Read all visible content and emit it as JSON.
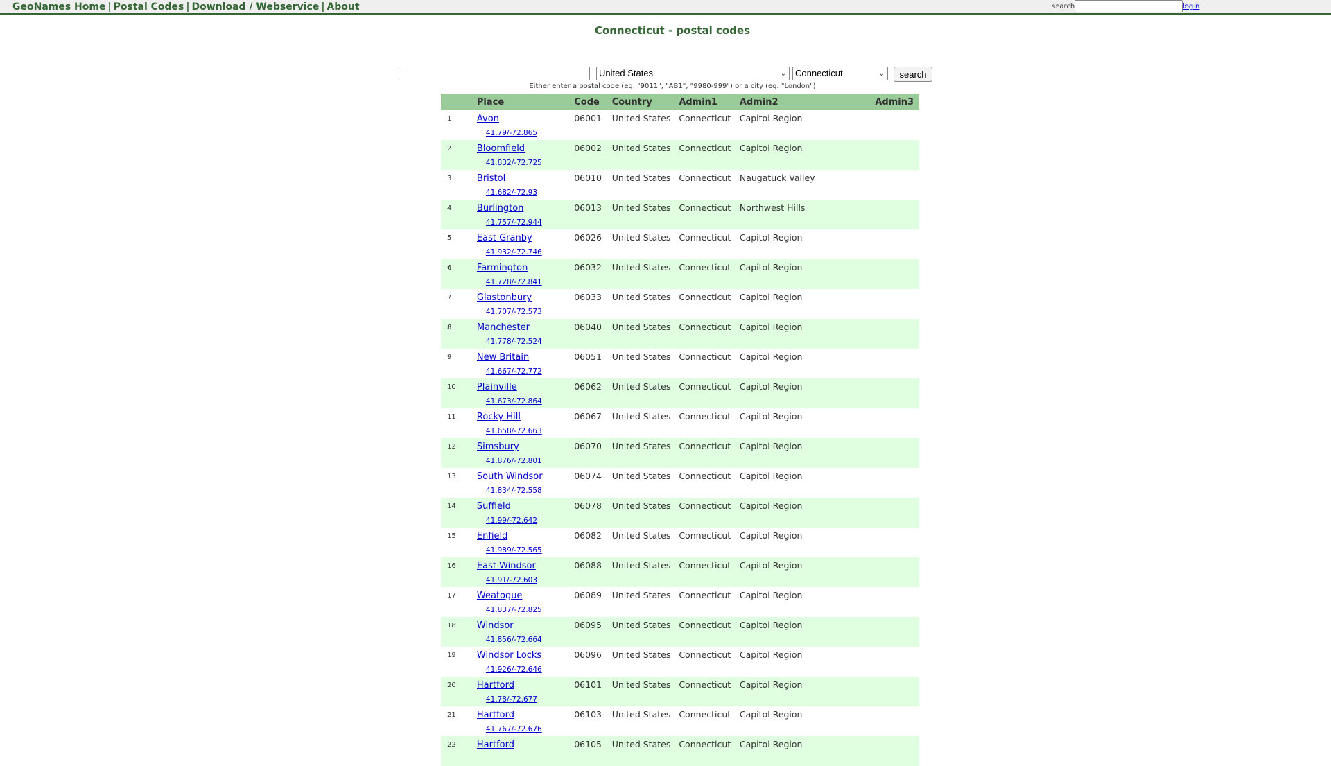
{
  "nav": {
    "items": [
      {
        "label": "GeoNames Home"
      },
      {
        "label": "Postal Codes"
      },
      {
        "label": "Download / Webservice"
      },
      {
        "label": "About"
      }
    ],
    "search_label": "search",
    "search_value": "",
    "login_label": "login"
  },
  "page_title": "Connecticut - postal codes",
  "search_form": {
    "query_value": "",
    "country_selected": "United States",
    "admin_selected": "Connecticut",
    "search_button": "search",
    "hint": "Either enter a postal code (eg. \"9011\", \"AB1\", \"9980-999\") or a city (eg. \"London\")"
  },
  "table": {
    "headers": [
      "",
      "Place",
      "Code",
      "Country",
      "Admin1",
      "Admin2",
      "Admin3"
    ],
    "rows": [
      {
        "n": "1",
        "place": "Avon",
        "coords": "41.79/-72.865",
        "code": "06001",
        "country": "United States",
        "admin1": "Connecticut",
        "admin2": "Capitol Region"
      },
      {
        "n": "2",
        "place": "Bloomfield",
        "coords": "41.832/-72.725",
        "code": "06002",
        "country": "United States",
        "admin1": "Connecticut",
        "admin2": "Capitol Region"
      },
      {
        "n": "3",
        "place": "Bristol",
        "coords": "41.682/-72.93",
        "code": "06010",
        "country": "United States",
        "admin1": "Connecticut",
        "admin2": "Naugatuck Valley"
      },
      {
        "n": "4",
        "place": "Burlington",
        "coords": "41.757/-72.944",
        "code": "06013",
        "country": "United States",
        "admin1": "Connecticut",
        "admin2": "Northwest Hills"
      },
      {
        "n": "5",
        "place": "East Granby",
        "coords": "41.932/-72.746",
        "code": "06026",
        "country": "United States",
        "admin1": "Connecticut",
        "admin2": "Capitol Region"
      },
      {
        "n": "6",
        "place": "Farmington",
        "coords": "41.728/-72.841",
        "code": "06032",
        "country": "United States",
        "admin1": "Connecticut",
        "admin2": "Capitol Region"
      },
      {
        "n": "7",
        "place": "Glastonbury",
        "coords": "41.707/-72.573",
        "code": "06033",
        "country": "United States",
        "admin1": "Connecticut",
        "admin2": "Capitol Region"
      },
      {
        "n": "8",
        "place": "Manchester",
        "coords": "41.778/-72.524",
        "code": "06040",
        "country": "United States",
        "admin1": "Connecticut",
        "admin2": "Capitol Region"
      },
      {
        "n": "9",
        "place": "New Britain",
        "coords": "41.667/-72.772",
        "code": "06051",
        "country": "United States",
        "admin1": "Connecticut",
        "admin2": "Capitol Region"
      },
      {
        "n": "10",
        "place": "Plainville",
        "coords": "41.673/-72.864",
        "code": "06062",
        "country": "United States",
        "admin1": "Connecticut",
        "admin2": "Capitol Region"
      },
      {
        "n": "11",
        "place": "Rocky Hill",
        "coords": "41.658/-72.663",
        "code": "06067",
        "country": "United States",
        "admin1": "Connecticut",
        "admin2": "Capitol Region"
      },
      {
        "n": "12",
        "place": "Simsbury",
        "coords": "41.876/-72.801",
        "code": "06070",
        "country": "United States",
        "admin1": "Connecticut",
        "admin2": "Capitol Region"
      },
      {
        "n": "13",
        "place": "South Windsor",
        "coords": "41.834/-72.558",
        "code": "06074",
        "country": "United States",
        "admin1": "Connecticut",
        "admin2": "Capitol Region"
      },
      {
        "n": "14",
        "place": "Suffield",
        "coords": "41.99/-72.642",
        "code": "06078",
        "country": "United States",
        "admin1": "Connecticut",
        "admin2": "Capitol Region"
      },
      {
        "n": "15",
        "place": "Enfield",
        "coords": "41.989/-72.565",
        "code": "06082",
        "country": "United States",
        "admin1": "Connecticut",
        "admin2": "Capitol Region"
      },
      {
        "n": "16",
        "place": "East Windsor",
        "coords": "41.91/-72.603",
        "code": "06088",
        "country": "United States",
        "admin1": "Connecticut",
        "admin2": "Capitol Region"
      },
      {
        "n": "17",
        "place": "Weatogue",
        "coords": "41.837/-72.825",
        "code": "06089",
        "country": "United States",
        "admin1": "Connecticut",
        "admin2": "Capitol Region"
      },
      {
        "n": "18",
        "place": "Windsor",
        "coords": "41.856/-72.664",
        "code": "06095",
        "country": "United States",
        "admin1": "Connecticut",
        "admin2": "Capitol Region"
      },
      {
        "n": "19",
        "place": "Windsor Locks",
        "coords": "41.926/-72.646",
        "code": "06096",
        "country": "United States",
        "admin1": "Connecticut",
        "admin2": "Capitol Region"
      },
      {
        "n": "20",
        "place": "Hartford",
        "coords": "41.78/-72.677",
        "code": "06101",
        "country": "United States",
        "admin1": "Connecticut",
        "admin2": "Capitol Region"
      },
      {
        "n": "21",
        "place": "Hartford",
        "coords": "41.767/-72.676",
        "code": "06103",
        "country": "United States",
        "admin1": "Connecticut",
        "admin2": "Capitol Region"
      },
      {
        "n": "22",
        "place": "Hartford",
        "coords": "",
        "code": "06105",
        "country": "United States",
        "admin1": "Connecticut",
        "admin2": "Capitol Region"
      }
    ]
  }
}
